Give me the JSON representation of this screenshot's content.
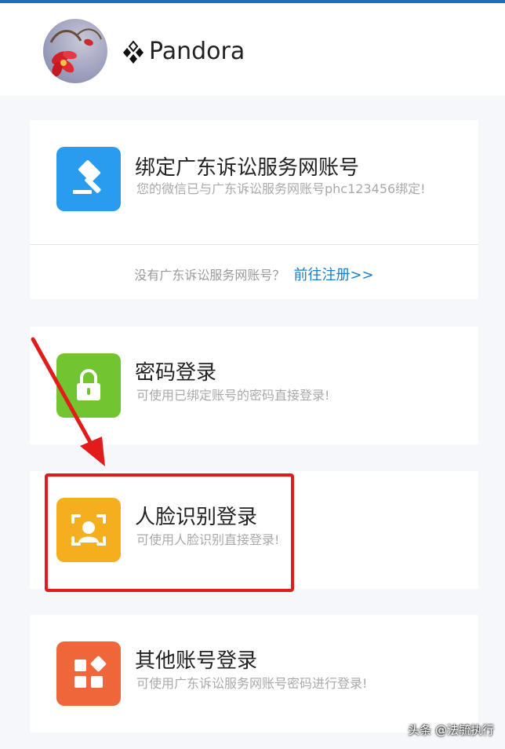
{
  "profile": {
    "username": "Pandora",
    "username_icon": "diamond-cluster-icon"
  },
  "account_card": {
    "title": "绑定广东诉讼服务网账号",
    "description": "您的微信已与广东诉讼服务网账号phc123456绑定!",
    "icon": "gavel-icon",
    "footer_prompt": "没有广东诉讼服务网账号？",
    "register_link": "前往注册>>",
    "accent_color": "#2a9cf0"
  },
  "login_options": [
    {
      "title": "密码登录",
      "description": "可使用已绑定账号的密码直接登录!",
      "icon": "lock-icon",
      "color": "#72c531"
    },
    {
      "title": "人脸识别登录",
      "description": "可使用人脸识别直接登录!",
      "icon": "face-scan-icon",
      "color": "#f4ae1e"
    },
    {
      "title": "其他账号登录",
      "description": "可使用广东诉讼服务网账号密码进行登录!",
      "icon": "apps-icon",
      "color": "#f0663b"
    }
  ],
  "annotation": {
    "highlight_color": "#e21b1b"
  },
  "watermark": "头条 @法毓执行"
}
